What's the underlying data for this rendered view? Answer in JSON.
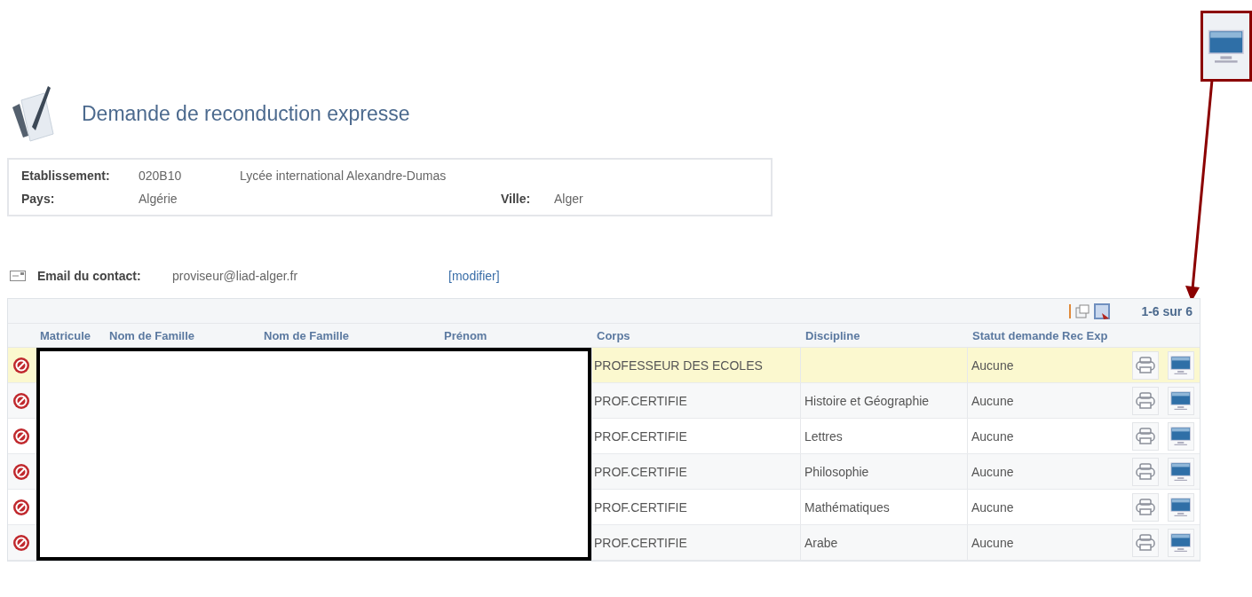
{
  "page": {
    "title": "Demande de reconduction expresse"
  },
  "etablissement": {
    "label": "Etablissement:",
    "code": "020B10",
    "name": "Lycée international Alexandre-Dumas",
    "pays_label": "Pays:",
    "pays": "Algérie",
    "ville_label": "Ville:",
    "ville": "Alger"
  },
  "contact": {
    "label": "Email du contact:",
    "email": "proviseur@liad-alger.fr",
    "link": "[modifier]"
  },
  "table": {
    "pagination": "1-6 sur 6",
    "columns": [
      "Matricule",
      "Nom de Famille",
      "Nom de Famille",
      "Prénom",
      "Corps",
      "Discipline",
      "Statut demande Rec Exp"
    ],
    "rows": [
      {
        "selected": true,
        "corps": "PROFESSEUR DES ECOLES",
        "statut": "Aucune"
      },
      {
        "selected": false,
        "corps": "PROF.CERTIFIE",
        "discipline": "Histoire et Géographie",
        "statut": "Aucune"
      },
      {
        "selected": false,
        "corps": "PROF.CERTIFIE",
        "discipline": "Lettres",
        "statut": "Aucune"
      },
      {
        "selected": false,
        "corps": "PROF.CERTIFIE",
        "discipline": "Philosophie",
        "statut": "Aucune"
      },
      {
        "selected": false,
        "corps": "PROF.CERTIFIE",
        "discipline": "Mathématiques",
        "statut": "Aucune"
      },
      {
        "selected": false,
        "corps": "PROF.CERTIFIE",
        "discipline": "Arabe",
        "statut": "Aucune"
      }
    ]
  }
}
